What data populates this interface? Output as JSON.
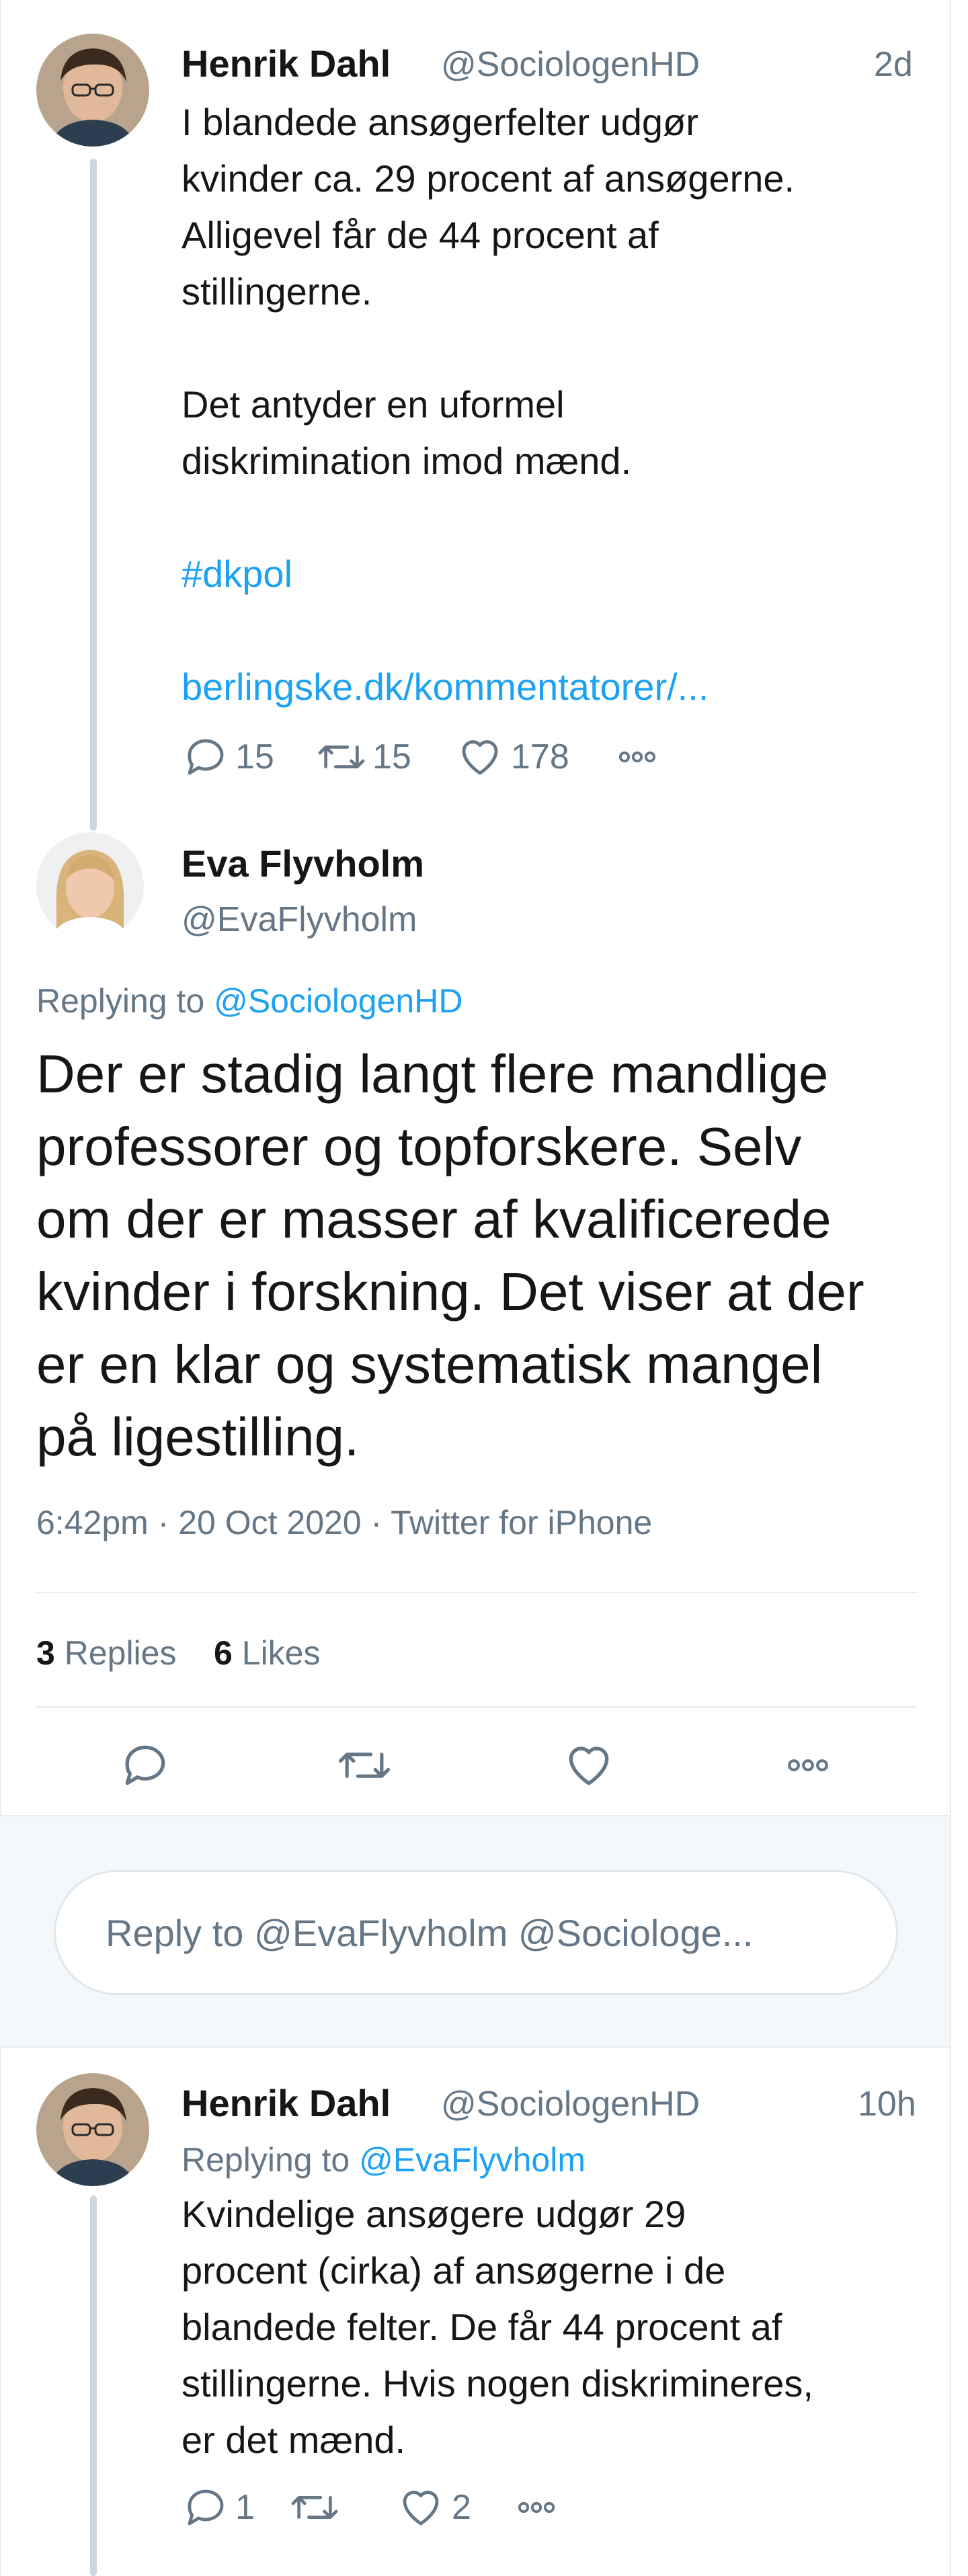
{
  "tweet1": {
    "name": "Henrik Dahl",
    "handle": "@SociologenHD",
    "time": "2d",
    "lines": [
      "I blandede ansøgerfelter udgør",
      "kvinder ca. 29 procent af ansøgerne.",
      "Alligevel får de 44 procent af",
      "stillingerne.",
      "Det antyder en uformel",
      "diskrimination imod mænd."
    ],
    "hashtag": "#dkpol",
    "url": "berlingske.dk/kommentatorer/...",
    "replies": "15",
    "retweets": "15",
    "likes": "178",
    "avatar_icon": "person-avatar-icon"
  },
  "main_tweet": {
    "name": "Eva Flyvholm",
    "handle": "@EvaFlyvholm",
    "replying_prefix": "Replying to",
    "replying_to": "@SociologenHD",
    "lines": [
      "Der er stadig langt flere mandlige",
      "professorer og topforskere. Selv",
      "om der er masser af kvalificerede",
      "kvinder i forskning. Det viser at der",
      "er en klar og systematisk mangel",
      "på ligestilling."
    ],
    "meta": "6:42pm · 20 Oct 2020 · Twitter for iPhone",
    "reply_count": "3",
    "replies_label": "Replies",
    "like_count": "6",
    "likes_label": "Likes",
    "avatar_icon": "person-avatar-icon"
  },
  "compose": {
    "placeholder": "Reply to @EvaFlyvholm @Sociologe..."
  },
  "tweet3": {
    "name": "Henrik Dahl",
    "handle": "@SociologenHD",
    "time": "10h",
    "replying_prefix": "Replying to",
    "replying_to": "@EvaFlyvholm",
    "lines": [
      "Kvindelige ansøgere udgør 29",
      "procent (cirka) af ansøgerne i de",
      "blandede felter. De får 44 procent af",
      "stillingerne. Hvis nogen diskrimineres,",
      "er det mænd."
    ],
    "replies": "1",
    "likes": "2"
  },
  "colors": {
    "link": "#1da1f2",
    "secondary": "#657786",
    "border": "#e6ecf0",
    "background_gray": "#f5f8fa"
  }
}
